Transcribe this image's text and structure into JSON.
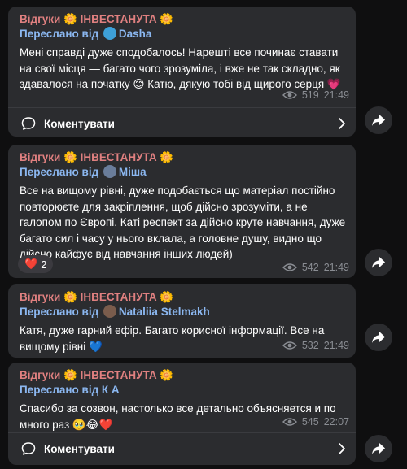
{
  "messages": [
    {
      "channel": "Відгуки 🌼 ІНВЕСТАНУТА 🌼",
      "forwarded_label": "Переслано від",
      "sender": "Dasha",
      "text": "Мені справді дуже сподобалось! Нарешті все починає ставати на свої місця — багато чого зрозуміла, і вже не так складно, як здавалося на початку 😊 Катю, дякую тобі від щирого серця 💗",
      "views": "519",
      "time": "21:49",
      "comments_label": "Коментувати"
    },
    {
      "channel": "Відгуки 🌼 ІНВЕСТАНУТА 🌼",
      "forwarded_label": "Переслано від",
      "sender": "Міша",
      "text": "Все на вищому рівні, дуже подобається що матеріал постійно повторюєте для закріплення, щоб дійсно зрозуміти, а не галопом по Європі. Каті респект за дійсно круте навчання, дуже багато сил і часу у нього вклала, а головне душу, видно що дійсно кайфує від навчання інших людей)",
      "reaction_emoji": "❤️",
      "reaction_count": "2",
      "views": "542",
      "time": "21:49"
    },
    {
      "channel": "Відгуки 🌼 ІНВЕСТАНУТА 🌼",
      "forwarded_label": "Переслано від",
      "sender": "Nataliia Stelmakh",
      "text": "Катя, дуже гарний ефір. Багато корисної інформації. Все на вищому рівні 💙",
      "views": "532",
      "time": "21:49"
    },
    {
      "channel": "Відгуки 🌼 ІНВЕСТАНУТА 🌼",
      "forwarded_label": "Переслано від",
      "sender": "К А",
      "text": "Спасибо за созвон, настолько все детально объясняется и по много раз 🥹😂❤️",
      "views": "545",
      "time": "22:07",
      "comments_label": "Коментувати"
    }
  ],
  "colors": {
    "background": "#0f0f10",
    "bubble": "#2b2c2f",
    "channel_name": "#e08080",
    "forward_link": "#8bb7f0",
    "meta_text": "#8a8d93",
    "dasha_avatar": "#3ea0d8",
    "misha_avatar": "#6a7d9a",
    "nataliia_avatar": "#7a5c4c"
  },
  "icons": [
    "eye-icon",
    "comment-icon",
    "chevron-right-icon",
    "share-icon",
    "flower-emoji"
  ]
}
